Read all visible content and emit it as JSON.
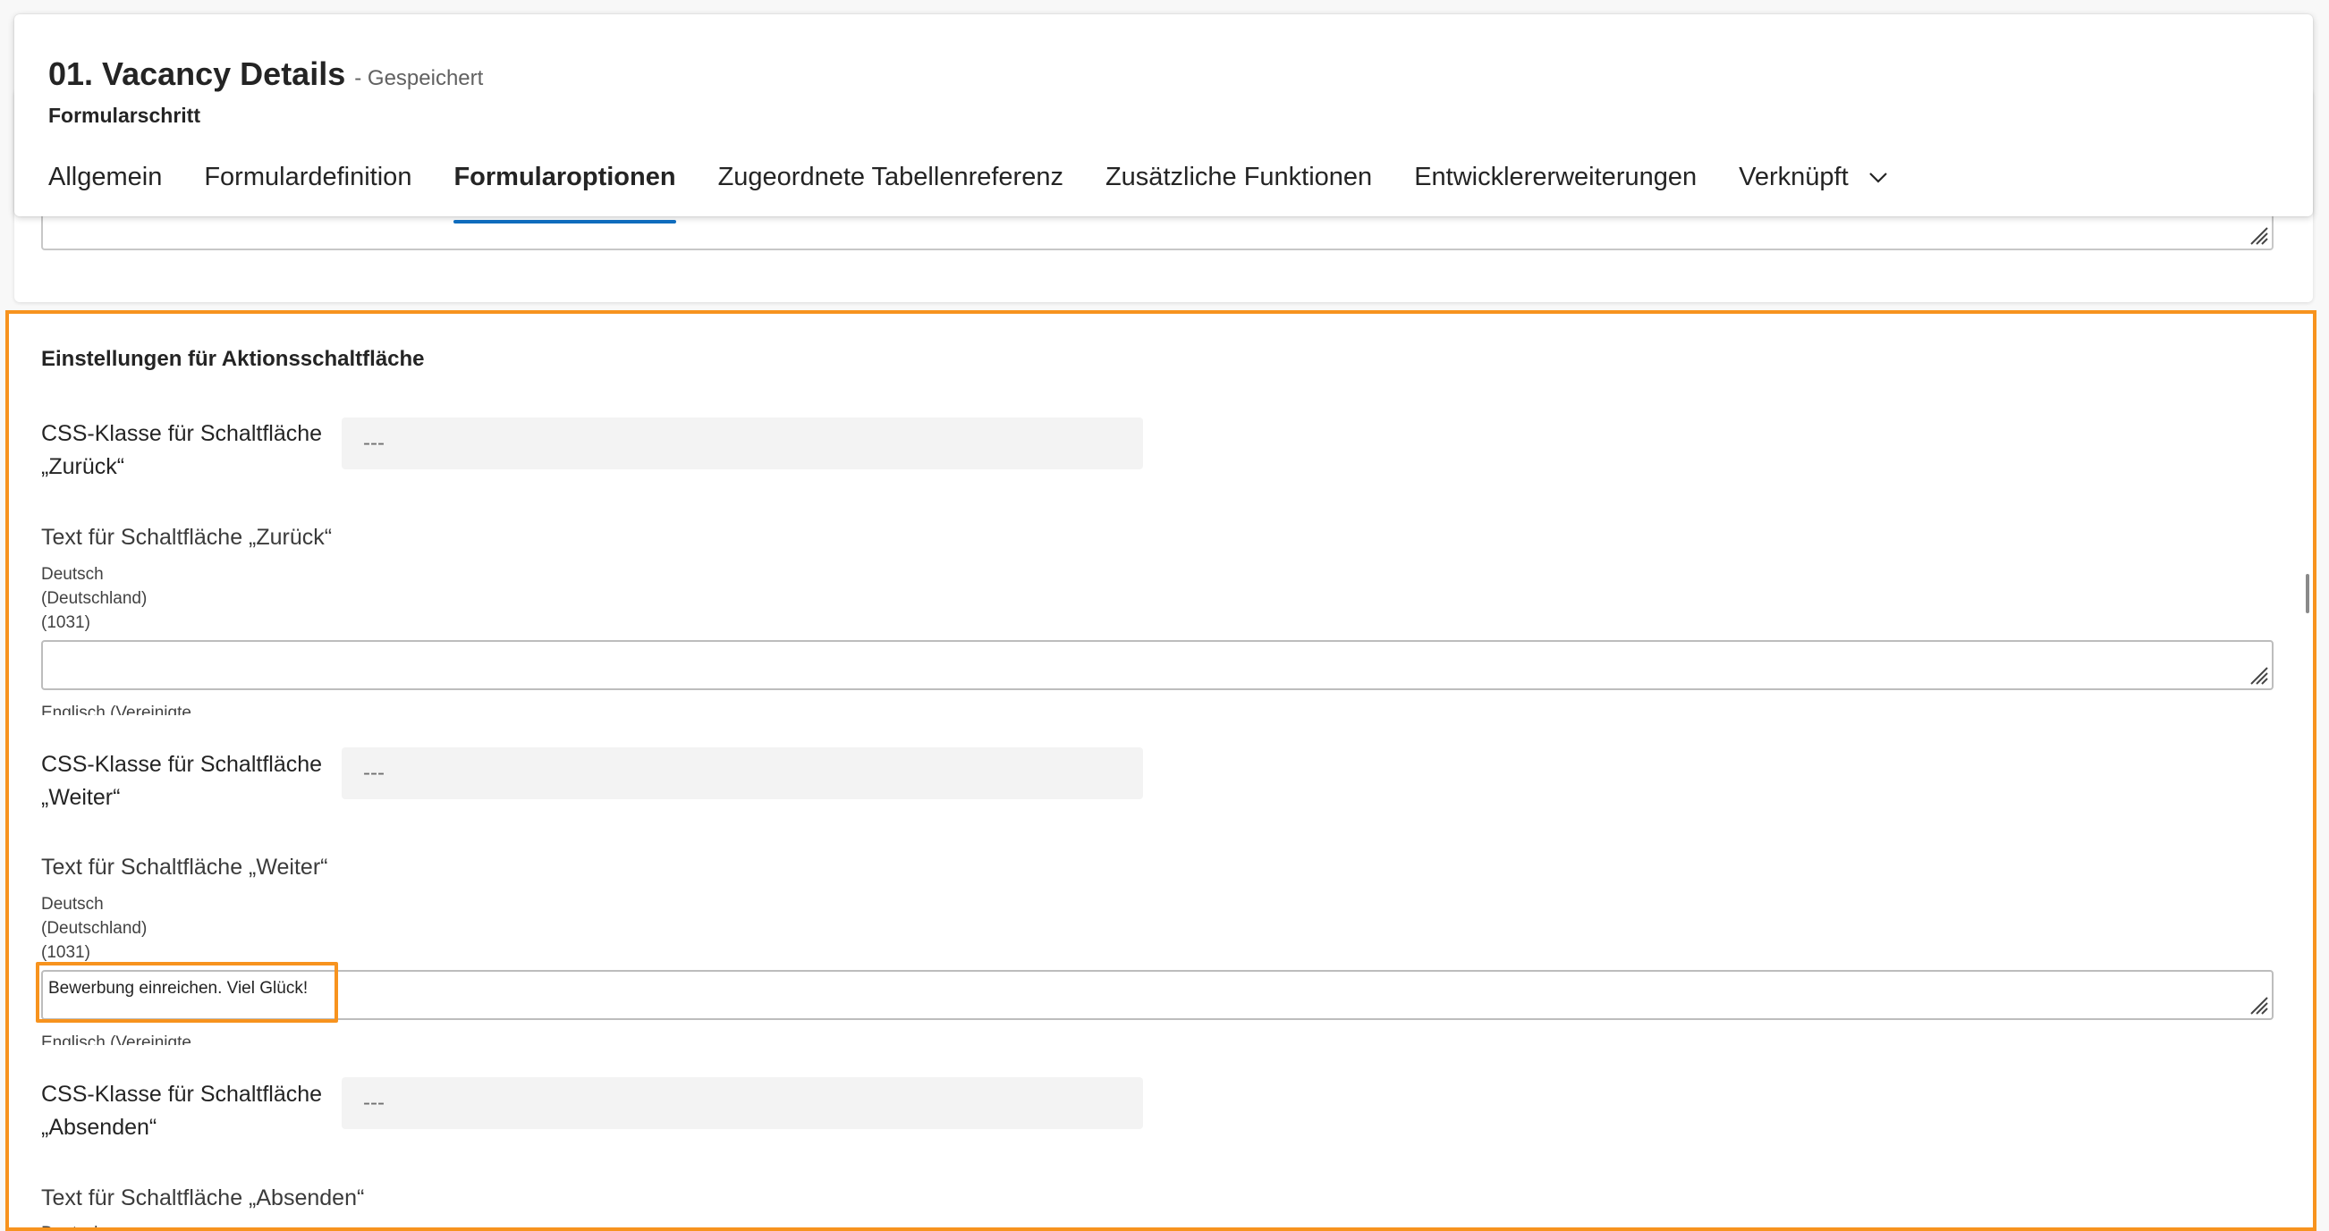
{
  "header": {
    "title": "01. Vacancy Details",
    "saved_status": "- Gespeichert",
    "entity_type": "Formularschritt"
  },
  "tabs": [
    {
      "label": "Allgemein",
      "active": false
    },
    {
      "label": "Formulardefinition",
      "active": false
    },
    {
      "label": "Formularoptionen",
      "active": true
    },
    {
      "label": "Zugeordnete Tabellenreferenz",
      "active": false
    },
    {
      "label": "Zusätzliche Funktionen",
      "active": false
    },
    {
      "label": "Entwicklererweiterungen",
      "active": false
    },
    {
      "label": "Verknüpft",
      "active": false,
      "icon": "chevron-down-icon"
    }
  ],
  "section": {
    "title": "Einstellungen für Aktionsschaltfläche",
    "back_css": {
      "label_line1": "CSS-Klasse für Schaltfläche",
      "label_line2": "„Zurück“",
      "value": "---"
    },
    "back_text": {
      "label": "Text für Schaltfläche „Zurück“",
      "lang_line1": "Deutsch",
      "lang_line2": "(Deutschland)",
      "lang_line3": "(1031)",
      "value": "",
      "next_lang": "Englisch (Vereinigte"
    },
    "next_css": {
      "label_line1": "CSS-Klasse für Schaltfläche",
      "label_line2": "„Weiter“",
      "value": "---"
    },
    "next_text": {
      "label": "Text für Schaltfläche „Weiter“",
      "lang_line1": "Deutsch",
      "lang_line2": "(Deutschland)",
      "lang_line3": "(1031)",
      "value": "Bewerbung einreichen. Viel Glück!",
      "next_lang": "Englisch (Vereinigte"
    },
    "submit_css": {
      "label_line1": "CSS-Klasse für Schaltfläche",
      "label_line2": "„Absenden“",
      "value": "---"
    },
    "submit_text": {
      "label": "Text für Schaltfläche „Absenden“",
      "next_lang": "Deutsch"
    }
  },
  "colors": {
    "accent": "#0f6cbd",
    "highlight": "#f7931e"
  }
}
